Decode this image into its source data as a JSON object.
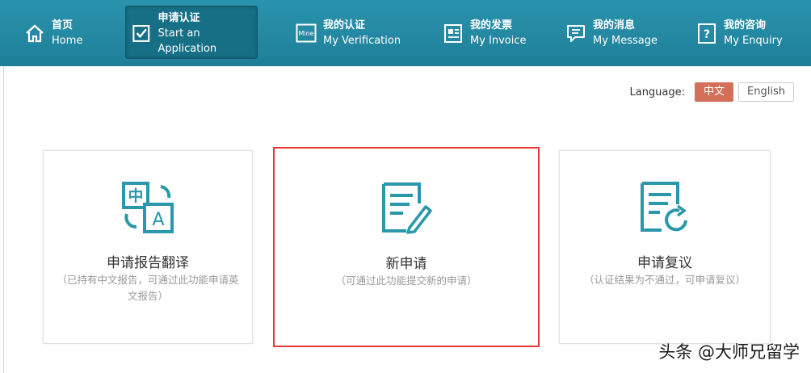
{
  "nav": {
    "items": [
      {
        "zh": "首页",
        "en": "Home",
        "icon": "home-icon"
      },
      {
        "zh": "申请认证",
        "en": "Start an Application",
        "icon": "checkbox-icon"
      },
      {
        "zh": "我的认证",
        "en": "My Verification",
        "icon": "mine-icon"
      },
      {
        "zh": "我的发票",
        "en": "My Invoice",
        "icon": "invoice-icon"
      },
      {
        "zh": "我的消息",
        "en": "My Message",
        "icon": "message-icon"
      },
      {
        "zh": "我的咨询",
        "en": "My Enquiry",
        "icon": "question-icon"
      }
    ],
    "mine_badge": "Mine"
  },
  "language": {
    "label": "Language:",
    "options": [
      "中文",
      "English"
    ],
    "selected": "中文"
  },
  "cards": [
    {
      "title": "申请报告翻译",
      "desc": "（已持有中文报告，可通过此功能申请英文报告）",
      "icon": "translate-icon",
      "icon_text_zh": "中",
      "icon_text_a": "A"
    },
    {
      "title": "新申请",
      "desc": "（可通过此功能提交新的申请）",
      "icon": "new-application-icon"
    },
    {
      "title": "申请复议",
      "desc": "（认证结果为不通过，可申请复议）",
      "icon": "reconsider-icon"
    }
  ],
  "watermark": "头条 @大师兄留学",
  "colors": {
    "nav": "#1f8aa5",
    "accent": "#2a97ab",
    "lang_on": "#d46f5a",
    "highlight": "#e53935"
  }
}
